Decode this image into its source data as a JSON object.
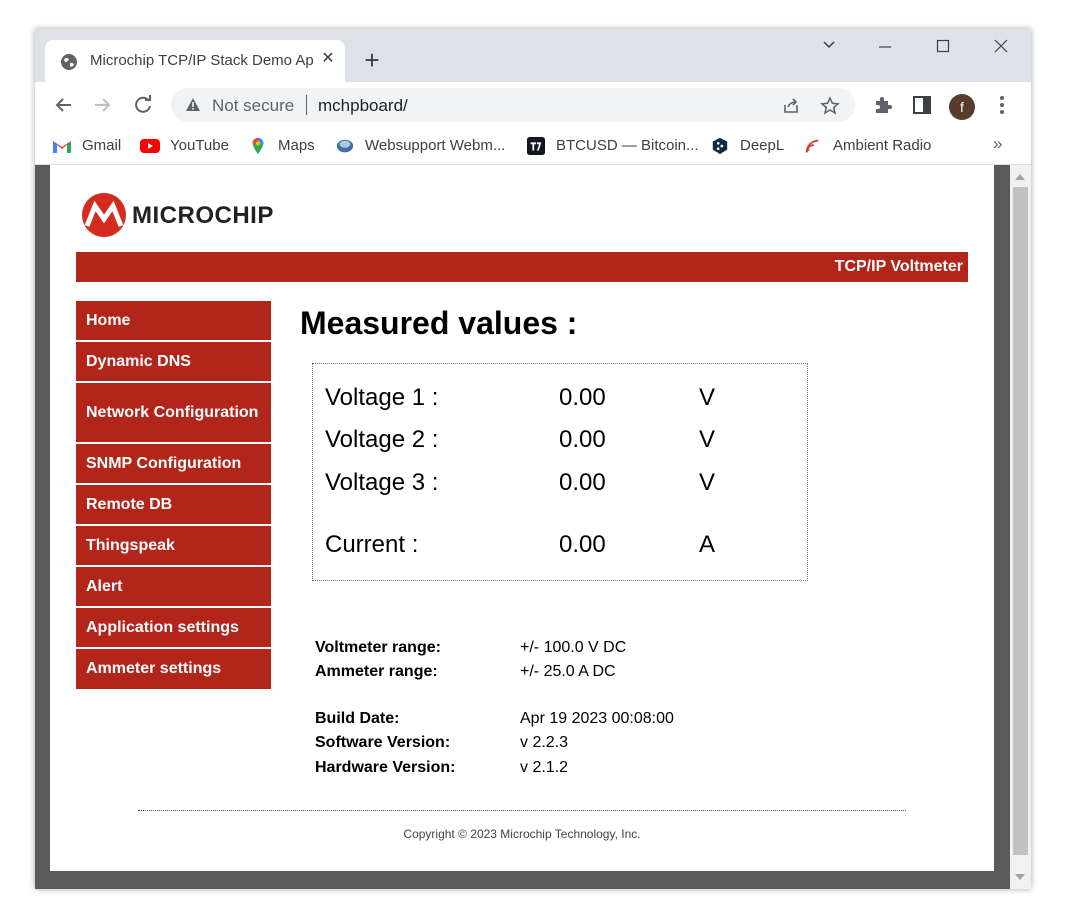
{
  "browser": {
    "tab_title": "Microchip TCP/IP Stack Demo Ap",
    "address": {
      "security_label": "Not secure",
      "url": "mchpboard/"
    },
    "profile_initial": "f",
    "bookmarks": [
      {
        "label": "Gmail",
        "icon": "gmail-icon"
      },
      {
        "label": "YouTube",
        "icon": "youtube-icon"
      },
      {
        "label": "Maps",
        "icon": "maps-icon"
      },
      {
        "label": "Websupport Webm...",
        "icon": "websupport-icon"
      },
      {
        "label": "BTCUSD — Bitcoin...",
        "icon": "tradingview-icon"
      },
      {
        "label": "DeepL",
        "icon": "deepl-icon"
      },
      {
        "label": "Ambient Radio",
        "icon": "ambient-radio-icon"
      }
    ],
    "bookmarks_overflow": "»"
  },
  "page": {
    "logo_text": "MICROCHIP",
    "banner": "TCP/IP Voltmeter",
    "menu": [
      "Home",
      "Dynamic DNS",
      "Network Configuration",
      "SNMP Configuration",
      "Remote DB",
      "Thingspeak",
      "Alert",
      "Application settings",
      "Ammeter settings"
    ],
    "heading": "Measured values :",
    "measurements": [
      {
        "label": "Voltage 1 :",
        "value": "0.00",
        "unit": "V"
      },
      {
        "label": "Voltage 2 :",
        "value": "0.00",
        "unit": "V"
      },
      {
        "label": "Voltage 3 :",
        "value": "0.00",
        "unit": "V"
      },
      {
        "label": "Current :",
        "value": "0.00",
        "unit": "A"
      }
    ],
    "info": [
      {
        "key": "Voltmeter range:",
        "value": "+/- 100.0 V DC"
      },
      {
        "key": "Ammeter range:",
        "value": "+/- 25.0 A DC"
      },
      {
        "key": "Build Date:",
        "value": "Apr 19 2023 00:08:00"
      },
      {
        "key": "Software Version:",
        "value": "v 2.2.3"
      },
      {
        "key": "Hardware Version:",
        "value": "v 2.1.2"
      }
    ],
    "copyright": "Copyright © 2023 Microchip Technology, Inc."
  },
  "colors": {
    "brand_red": "#b1251b",
    "chrome_frame": "#dee1e6"
  }
}
